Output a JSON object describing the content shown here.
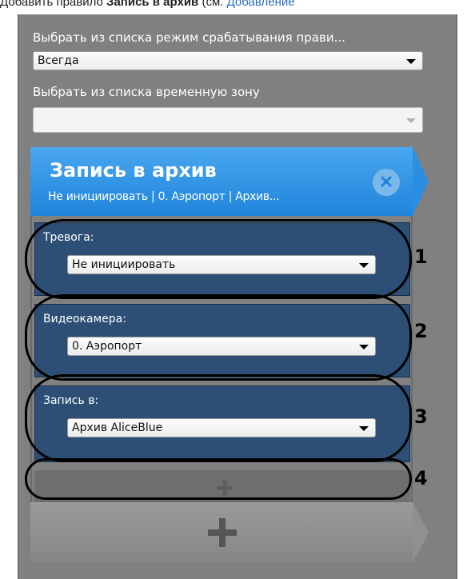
{
  "doc_line": {
    "prefix": "Добавить правило ",
    "bold": "Запись в архив",
    "middle": " (см. ",
    "link": "Добавление"
  },
  "trigger_mode": {
    "label": "Выбрать из  списка режим срабатывания прави...",
    "value": "Всегда"
  },
  "time_zone": {
    "label": "Выбрать из списка временную зону",
    "value": ""
  },
  "rule": {
    "title": "Запись в архив",
    "subtitle": "Не инициировать | 0. Аэропорт | Архив...",
    "close_symbol": "✕",
    "fields": [
      {
        "label": "Тревога:",
        "value": "Не инициировать"
      },
      {
        "label": "Видеокамера:",
        "value": "0. Аэропорт"
      },
      {
        "label": "Запись в:",
        "value": "Архив AliceBlue"
      }
    ]
  },
  "callouts": [
    "1",
    "2",
    "3",
    "4"
  ]
}
